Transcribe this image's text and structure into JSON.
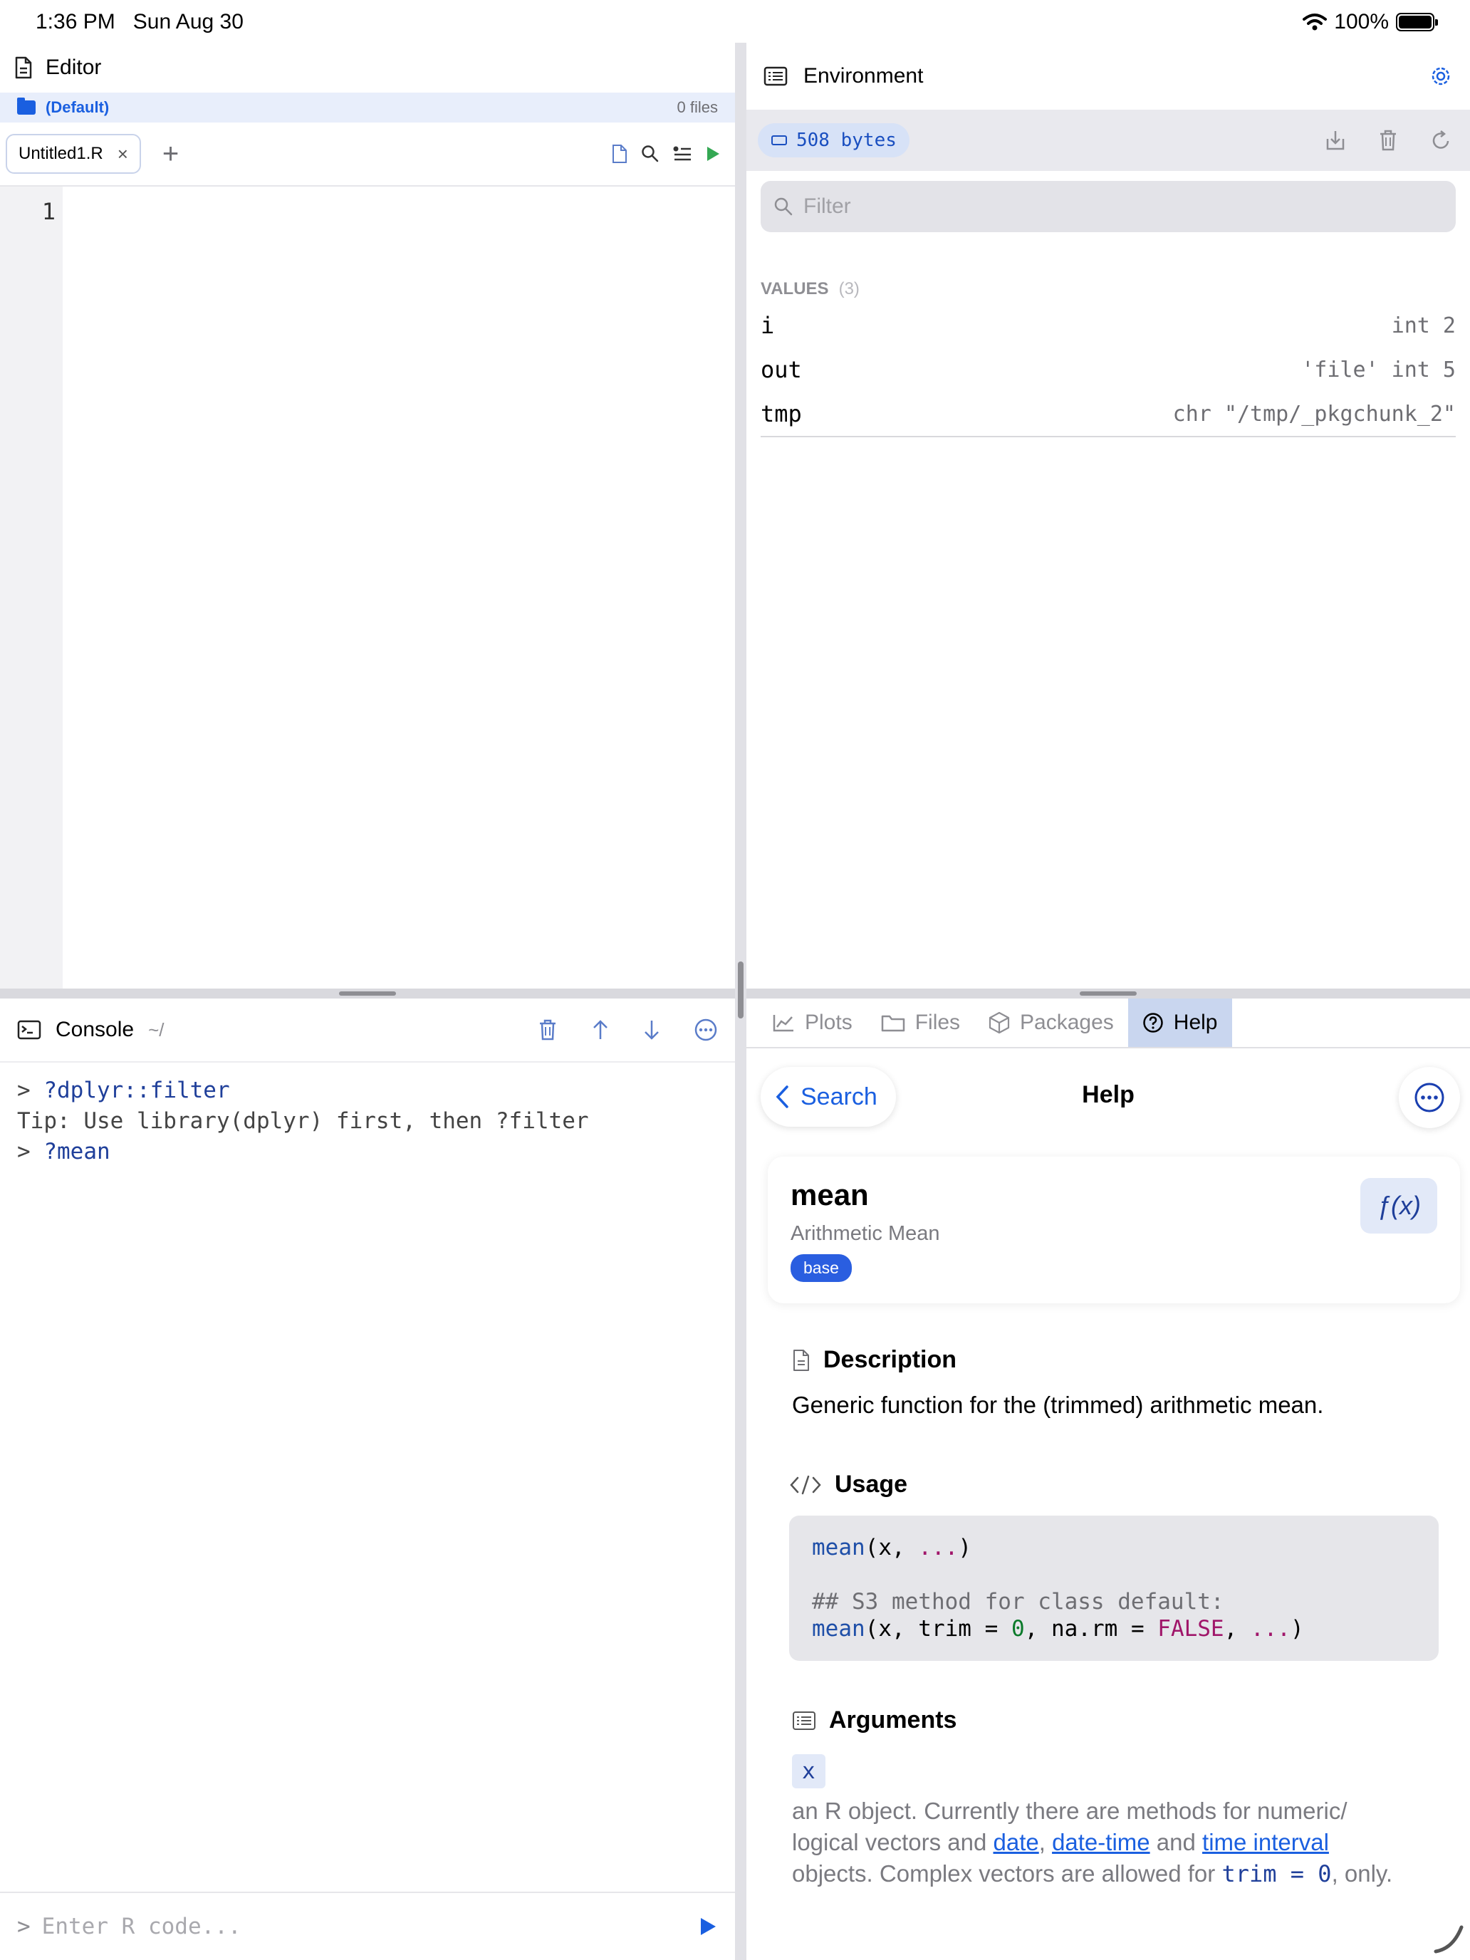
{
  "status_bar": {
    "time": "1:36 PM",
    "date": "Sun Aug 30",
    "battery": "100%"
  },
  "editor": {
    "title": "Editor",
    "project": {
      "name": "(Default)",
      "files": "0 files"
    },
    "tabs": [
      {
        "label": "Untitled1.R"
      }
    ],
    "line_numbers": [
      "1"
    ]
  },
  "environment": {
    "title": "Environment",
    "size": "508 bytes",
    "filter_placeholder": "Filter",
    "section_label": "VALUES",
    "section_count": "(3)",
    "variables": [
      {
        "name": "i",
        "value": "int 2"
      },
      {
        "name": "out",
        "value": "'file' int 5"
      },
      {
        "name": "tmp",
        "value": "chr \"/tmp/_pkgchunk_2\""
      }
    ]
  },
  "console": {
    "title": "Console",
    "path": "~/",
    "lines": [
      {
        "prompt": ">",
        "text": "?dplyr::filter"
      },
      {
        "text": "Tip: Use library(dplyr) first, then ?filter"
      },
      {
        "prompt": ">",
        "text": "?mean"
      }
    ],
    "input_prompt": ">",
    "input_placeholder": "Enter R code..."
  },
  "help_tabs": [
    "Plots",
    "Files",
    "Packages",
    "Help"
  ],
  "help": {
    "back_label": "Search",
    "title": "Help",
    "fn_name": "mean",
    "fn_subtitle": "Arithmetic Mean",
    "package": "base",
    "fx_label": "ƒ(x)",
    "description_heading": "Description",
    "description": "Generic function for the (trimmed) arithmetic mean.",
    "usage_heading": "Usage",
    "usage": {
      "line1_fn": "mean",
      "line1_args": "(x, ",
      "line1_dots": "...",
      "line1_close": ")",
      "comment": "## S3 method for class default:",
      "line2_fn": "mean",
      "line2_a": "(x, trim = ",
      "line2_zero": "0",
      "line2_b": ", na.rm = ",
      "line2_false": "FALSE",
      "line2_c": ", ",
      "line2_dots": "...",
      "line2_close": ")"
    },
    "arguments_heading": "Arguments",
    "arg_name": "x",
    "arg_text_1": "an R object. Currently there are methods for numeric/",
    "arg_text_2": "logical vectors and ",
    "link_date": "date",
    "comma": ", ",
    "link_datetime": "date-time",
    "and": " and ",
    "link_interval": "time interval",
    "arg_text_3": "objects. Complex vectors are allowed for ",
    "arg_code": "trim = 0",
    "arg_text_4": ", only."
  },
  "colors": {
    "accent": "#1a5fe0",
    "active_tab": "#c9d6ef",
    "run_green": "#34a853"
  }
}
